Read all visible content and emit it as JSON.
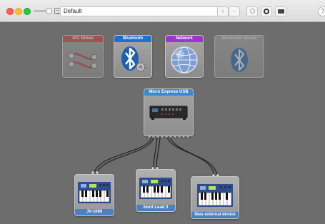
{
  "window": {
    "configuration": "Default",
    "help_label": "?"
  },
  "toolbar": {
    "add_label": "+",
    "remove_label": "−",
    "icons": [
      "zoom-slider",
      "configuration-select",
      "add",
      "remove",
      "device-info",
      "test-setup",
      "show-keyboard",
      "help"
    ]
  },
  "devices": [
    {
      "id": "iac",
      "title": "IAC Driver",
      "title_color": "#c6403a",
      "icon": "midi-cable-icon",
      "state": "inactive"
    },
    {
      "id": "bluetooth",
      "title": "Bluetooth",
      "title_color": "#1f6fd6",
      "icon": "bluetooth-gear-icon",
      "state": "active"
    },
    {
      "id": "network",
      "title": "Network",
      "title_color": "#9b35d1",
      "icon": "network-globe-icon",
      "state": "active"
    },
    {
      "id": "bt-device",
      "title": "Bluetooth device",
      "title_color": "#9a9a9a",
      "icon": "bluetooth-icon",
      "state": "offline"
    },
    {
      "id": "interface",
      "title": "Micro Express USB",
      "title_color": "#3c86d6",
      "icon": "midi-interface-icon",
      "state": "active"
    },
    {
      "id": "jv1080",
      "title": "",
      "label": "JV-1080",
      "icon": "keyboard-synth-icon",
      "state": "active"
    },
    {
      "id": "nord",
      "title": "",
      "label": "Nord Lead 3",
      "icon": "keyboard-synth-icon",
      "state": "active"
    },
    {
      "id": "new-ext",
      "title": "",
      "label": "New external device",
      "icon": "keyboard-synth-icon",
      "state": "active"
    }
  ],
  "colors": {
    "canvas": "#6d6d6d",
    "label_bar": "#4e7fbf"
  }
}
